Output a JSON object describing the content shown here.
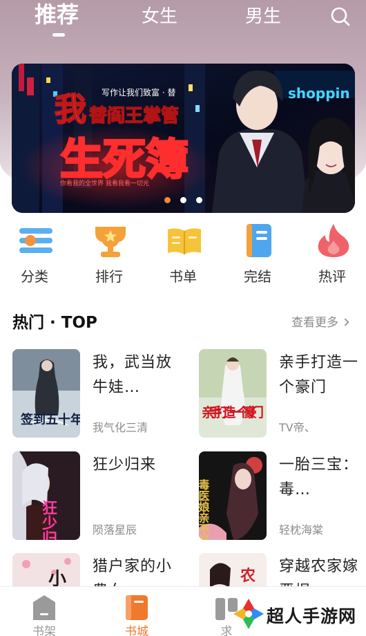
{
  "header": {
    "tabs": [
      {
        "label": "推荐",
        "active": true
      },
      {
        "label": "女生",
        "active": false
      },
      {
        "label": "男生",
        "active": false
      }
    ],
    "search_icon": "search-icon"
  },
  "banner": {
    "headline_char": "我",
    "subtitle": "写作让我们致富 · 替",
    "line2": "替阎王掌管",
    "big_title": "生死簿",
    "tagline": "你看我的全世界 我看我看一切光",
    "sign": "shoppin",
    "slide_count": 3,
    "active_slide": 0
  },
  "categories": [
    {
      "label": "分类",
      "icon": "menu-list-icon"
    },
    {
      "label": "排行",
      "icon": "trophy-icon"
    },
    {
      "label": "书单",
      "icon": "open-book-icon"
    },
    {
      "label": "完结",
      "icon": "book-done-icon"
    },
    {
      "label": "热评",
      "icon": "flame-icon"
    }
  ],
  "section": {
    "title": "热门 · TOP",
    "more": "查看更多"
  },
  "books": [
    {
      "title": "我，武当放牛娃…",
      "author": "我气化三清",
      "cover_text": "签到五十年"
    },
    {
      "title": "亲手打造一个豪门",
      "author": "TV帝、",
      "cover_text": "亲手打造一个豪门"
    },
    {
      "title": "狂少归来",
      "author": "陨落星辰",
      "cover_text": "狂少归来"
    },
    {
      "title": "一胎三宝：毒…",
      "author": "轻枕海棠",
      "cover_text": "毒医娘亲不好惹"
    },
    {
      "title": "猎户家的小農女",
      "author": "",
      "cover_text": "小"
    },
    {
      "title": "穿越农家嫁恶棍",
      "author": "",
      "cover_text": "农"
    }
  ],
  "bottom_nav": [
    {
      "label": "书架",
      "icon": "bookshelf-icon",
      "active": false
    },
    {
      "label": "书城",
      "icon": "bookstore-icon",
      "active": true
    },
    {
      "label": "求",
      "icon": "request-icon",
      "active": false
    }
  ],
  "watermark": {
    "text": "超人手游网"
  },
  "colors": {
    "accent": "#f07a2c",
    "header_bg": "#b59aa8"
  }
}
